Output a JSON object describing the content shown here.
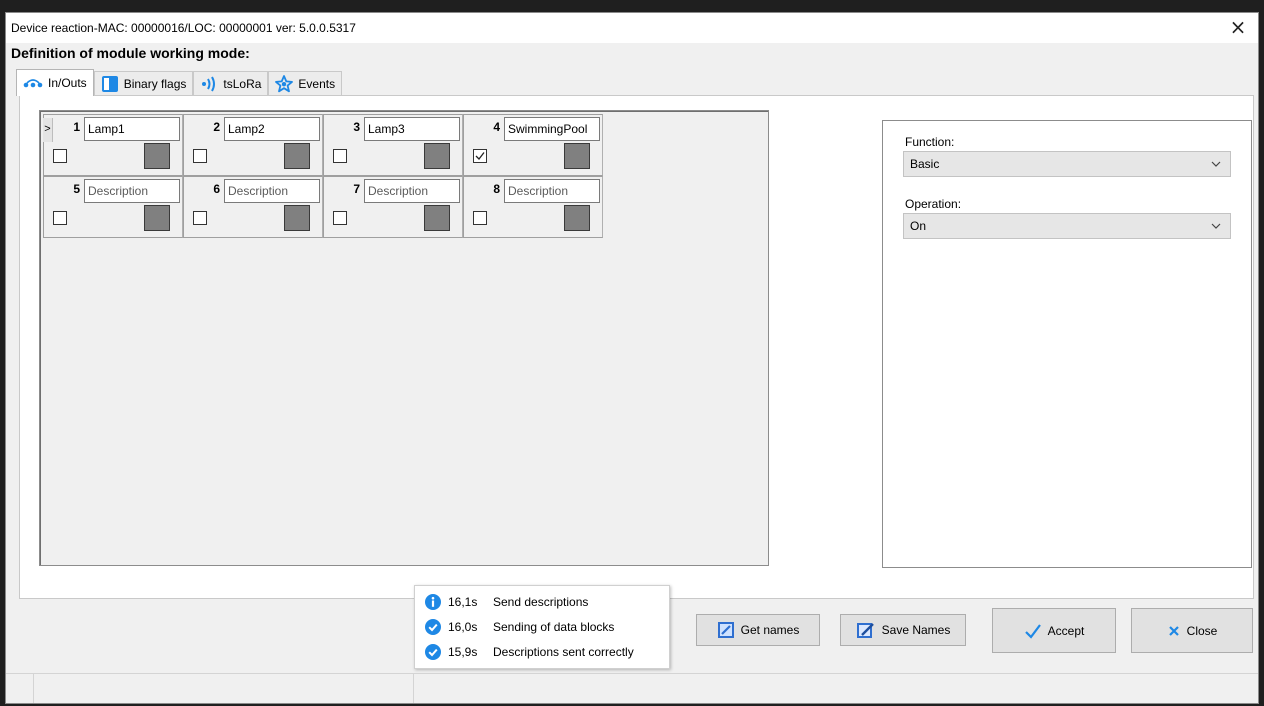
{
  "window": {
    "title": "Device reaction-MAC: 00000016/LOC: 00000001 ver: 5.0.0.5317",
    "close_glyph": "×"
  },
  "heading": "Definition of module working mode:",
  "tabs": [
    {
      "label": "In/Outs",
      "icon": "inouts-icon",
      "active": true
    },
    {
      "label": "Binary flags",
      "icon": "binary-flags-icon",
      "active": false
    },
    {
      "label": "tsLoRa",
      "icon": "lora-signal-icon",
      "active": false
    },
    {
      "label": "Events",
      "icon": "star-icon",
      "active": false
    }
  ],
  "channels": [
    {
      "number": "1",
      "name": "Lamp1",
      "checked": false,
      "selected_marker": ">"
    },
    {
      "number": "2",
      "name": "Lamp2",
      "checked": false
    },
    {
      "number": "3",
      "name": "Lamp3",
      "checked": false
    },
    {
      "number": "4",
      "name": "SwimmingPool",
      "checked": true
    },
    {
      "number": "5",
      "name": "Description",
      "checked": false
    },
    {
      "number": "6",
      "name": "Description",
      "checked": false
    },
    {
      "number": "7",
      "name": "Description",
      "checked": false
    },
    {
      "number": "8",
      "name": "Description",
      "checked": false
    }
  ],
  "properties": {
    "function_label": "Function:",
    "function_value": "Basic",
    "operation_label": "Operation:",
    "operation_value": "On"
  },
  "log": [
    {
      "time": "16,1s",
      "message": "Send descriptions",
      "icon": "info-icon"
    },
    {
      "time": "16,0s",
      "message": "Sending of data blocks",
      "icon": "check-circle-icon"
    },
    {
      "time": "15,9s",
      "message": "Descriptions sent correctly",
      "icon": "check-circle-icon"
    }
  ],
  "buttons": {
    "get_names": "Get names",
    "save_names": "Save Names",
    "accept": "Accept",
    "close": "Close"
  },
  "colors": {
    "accent_blue": "#1e88e5",
    "state_gray": "#808080"
  }
}
